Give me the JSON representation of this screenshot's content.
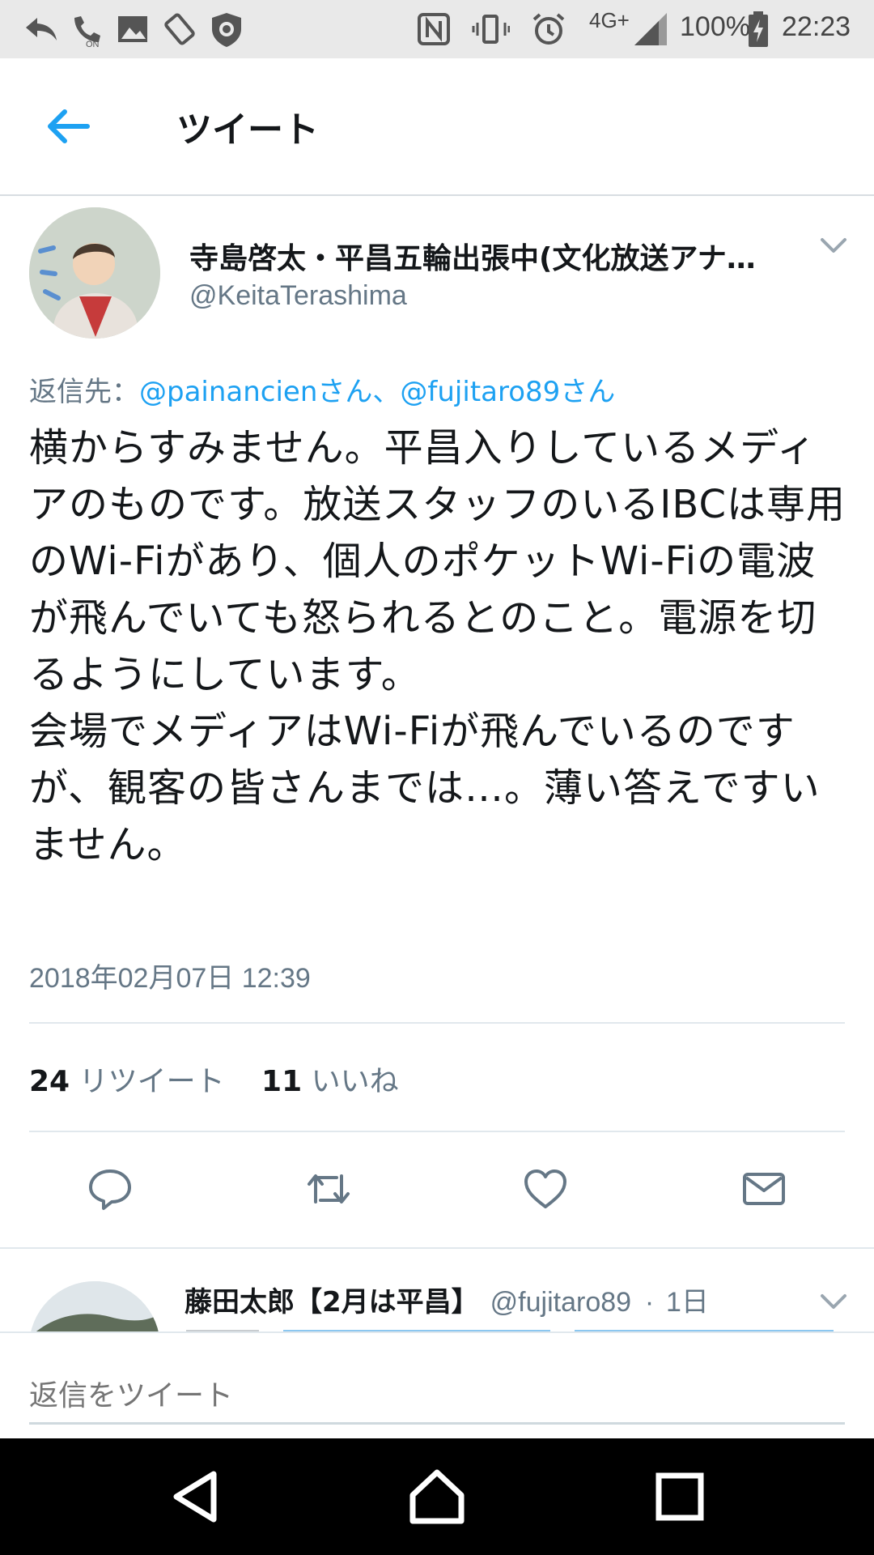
{
  "status_bar": {
    "network": "4G+",
    "battery": "100%",
    "time": "22:23",
    "icons": [
      "reply-arrow-icon",
      "wifi-calling-icon",
      "image-icon",
      "rotate-icon",
      "shield-icon",
      "nfc-icon",
      "vibrate-icon",
      "alarm-icon",
      "signal-icon",
      "battery-charging-icon"
    ]
  },
  "app_bar": {
    "title": "ツイート",
    "back_icon": "arrow-left-icon"
  },
  "tweet": {
    "display_name": "寺島啓太・平昌五輪出張中(文化放送アナ…",
    "handle": "@KeitaTerashima",
    "reply_to_label": "返信先：",
    "reply_to_users": "@painancienさん、@fujitaro89さん",
    "body": "横からすみません。平昌入りしているメディアのものです。放送スタッフのいるIBCは専用のWi-Fiがあり、個人のポケットWi-Fiの電波が飛んでいても怒られるとのこと。電源を切るようにしています。\n会場でメディアはWi-Fiが飛んでいるのですが、観客の皆さんまでは…。薄い答えですいません。",
    "timestamp": "2018年02月07日 12:39",
    "retweet_count": "24",
    "retweet_label": "リツイート",
    "like_count": "11",
    "like_label": "いいね"
  },
  "reply_preview": {
    "display_name": "藤田太郎【2月は平昌】",
    "handle": "@fujitaro89",
    "separator": "·",
    "time": "1日"
  },
  "composer": {
    "placeholder": "返信をツイート"
  },
  "colors": {
    "accent": "#1da1f2",
    "secondary_text": "#657786",
    "primary_text": "#14171a",
    "divider": "#e1e8ed"
  }
}
